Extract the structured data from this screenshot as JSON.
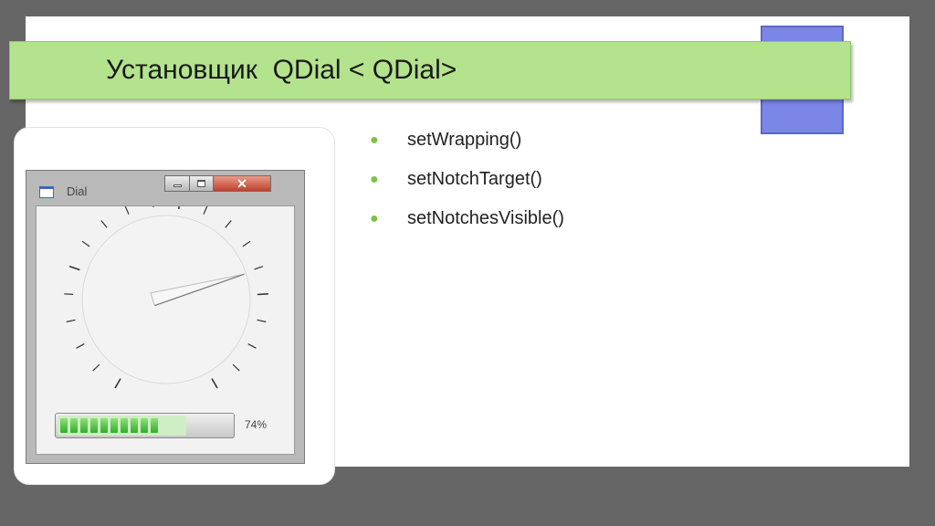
{
  "slide": {
    "title": "Установщик  QDial < QDial>",
    "methods": [
      {
        "label": "setWrapping()"
      },
      {
        "label": "setNotchTarget()"
      },
      {
        "label": "setNotchesVisible()"
      }
    ]
  },
  "window": {
    "title": "Dial",
    "buttons": {
      "close": "✕"
    }
  },
  "dial": {
    "min": 0,
    "max": 100,
    "value": 74,
    "notch_count": 20,
    "notches_visible": true,
    "wrapping": false
  },
  "progress": {
    "value": 74,
    "label": "74%",
    "segments": 10
  },
  "colors": {
    "background": "#666666",
    "title_bar": "#b4e38d",
    "bullet": "#7ac149",
    "accent_block": "#7b86e6",
    "progress_fill": "#3cb83a"
  }
}
